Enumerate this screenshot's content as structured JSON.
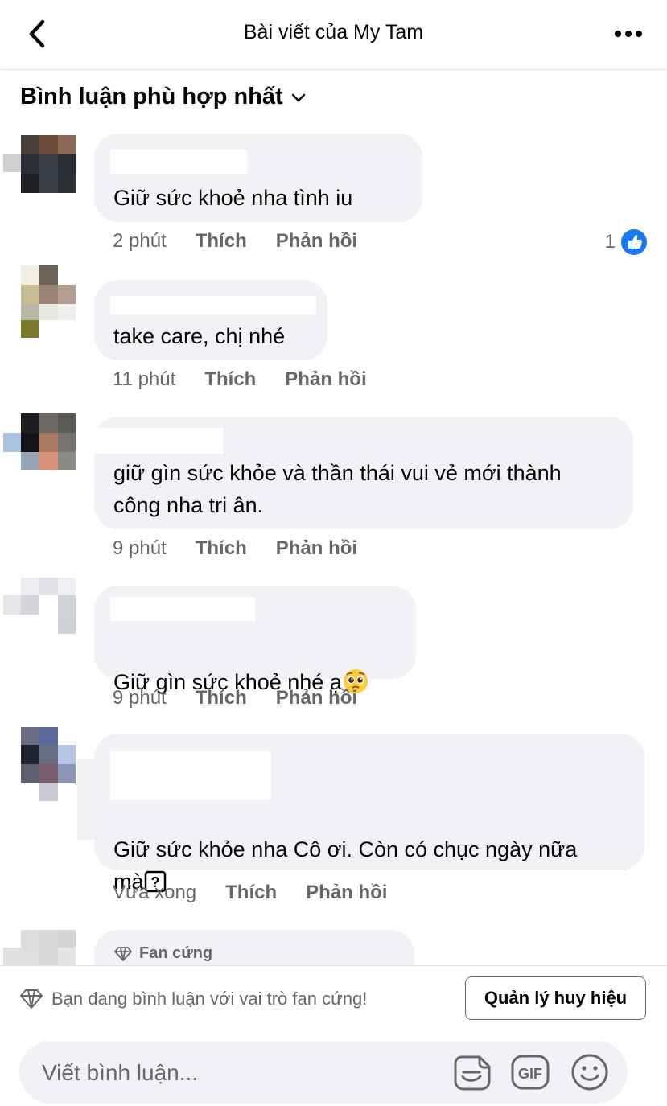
{
  "header": {
    "title": "Bài viết của My Tam"
  },
  "sort": {
    "label": "Bình luận phù hợp nhất"
  },
  "comments": [
    {
      "text": "Giữ sức khoẻ nha tình iu",
      "time": "2 phút",
      "like_label": "Thích",
      "reply_label": "Phản hồi",
      "like_count": "1"
    },
    {
      "text": "take care, chị nhé",
      "time": "11 phút",
      "like_label": "Thích",
      "reply_label": "Phản hồi"
    },
    {
      "text": "giữ gìn sức khỏe và thần thái vui vẻ mới thành\ncông nha tri ân.",
      "time": "9 phút",
      "like_label": "Thích",
      "reply_label": "Phản hồi"
    },
    {
      "text": "Giữ gìn sức khoẻ nhé ạ",
      "time": "9 phút",
      "like_label": "Thích",
      "reply_label": "Phản hồi",
      "emoji": "pleading-face"
    },
    {
      "text": "Giữ sức khỏe nha Cô ơi. Còn có chục ngày nữa\nmà",
      "time": "Vừa xong",
      "like_label": "Thích",
      "reply_label": "Phản hồi",
      "trailing_glyph": "unknown-char-box"
    },
    {
      "badge": "Fan cứng"
    }
  ],
  "notice": {
    "text": "Bạn đang bình luận với vai trò fan cứng!",
    "button": "Quản lý huy hiệu"
  },
  "composer": {
    "placeholder": "Viết bình luận...",
    "icons": [
      "sticker-icon",
      "gif-icon",
      "emoji-icon"
    ]
  },
  "colors": {
    "bubble": "#f0f2f5",
    "muted": "#65676b",
    "like_blue": "#1877f2"
  }
}
